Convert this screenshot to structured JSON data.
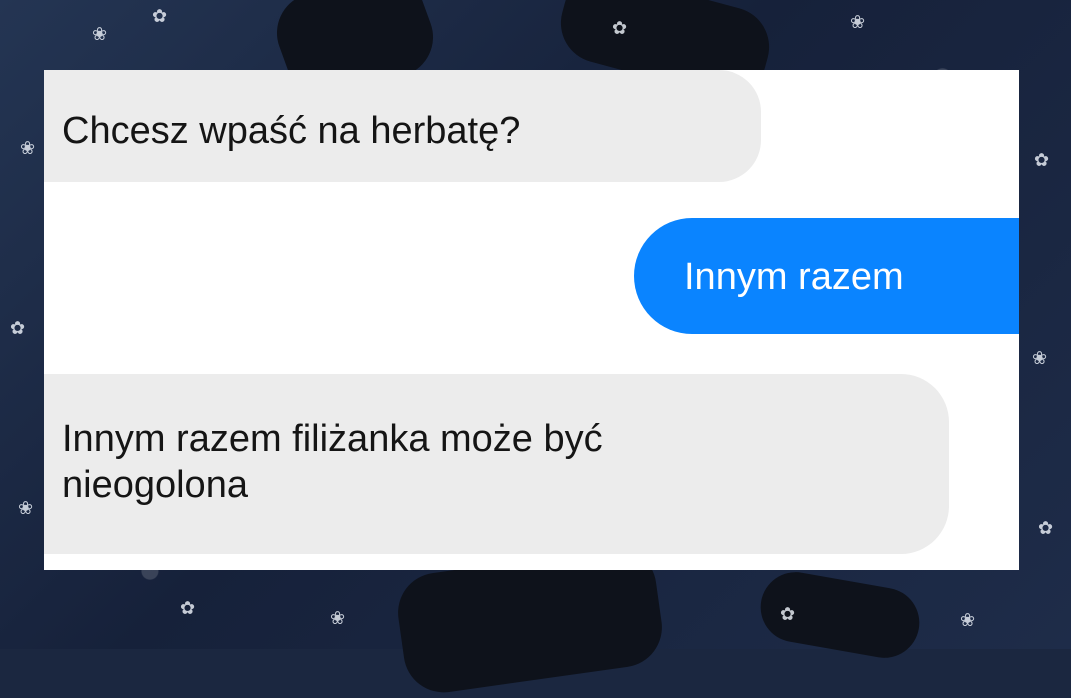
{
  "chat": {
    "messages": [
      {
        "sender": "incoming",
        "text": "Chcesz wpaść na herbatę?"
      },
      {
        "sender": "outgoing",
        "text": "Innym razem"
      },
      {
        "sender": "incoming",
        "lines": [
          "Innym razem filiżanka może być",
          "nieogolona"
        ]
      }
    ]
  },
  "colors": {
    "incoming_bubble": "#ececec",
    "outgoing_bubble": "#0a84ff",
    "panel": "#ffffff",
    "background": "#1b2740"
  },
  "icons": {
    "background_decoration": "blossom-icon"
  }
}
